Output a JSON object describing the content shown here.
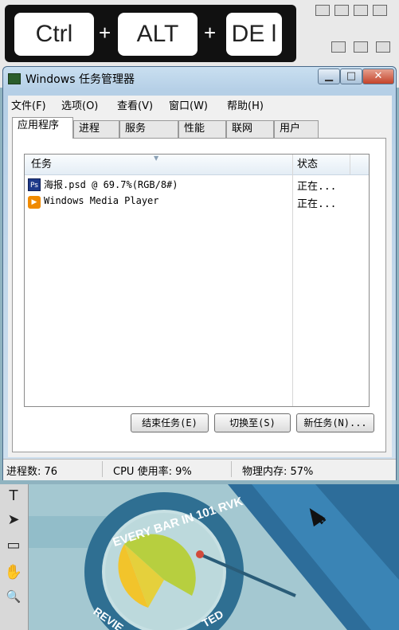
{
  "keys": {
    "ctrl": "Ctrl",
    "alt": "ALT",
    "del": "DE l",
    "plus": "+"
  },
  "window": {
    "title": "Windows 任务管理器",
    "min_label": "▁",
    "max_label": "□",
    "close_label": "✕"
  },
  "menu": [
    "文件(F)",
    "选项(O)",
    "查看(V)",
    "窗口(W)",
    "帮助(H)"
  ],
  "tabs": [
    "应用程序",
    "进程",
    "服务",
    "性能",
    "联网",
    "用户"
  ],
  "list": {
    "col_task": "任务",
    "col_status": "状态",
    "rows": [
      {
        "icon": "photoshop-icon",
        "name": "海报.psd @ 69.7%(RGB/8#)",
        "status": "正在...",
        "icon_color": "#1e3a8a"
      },
      {
        "icon": "media-player-icon",
        "name": "Windows Media Player",
        "status": "正在...",
        "icon_color": "#f08a00"
      }
    ]
  },
  "buttons": {
    "end_task": "结束任务(E)",
    "switch_to": "切换至(S)",
    "new_task": "新任务(N)..."
  },
  "status": {
    "processes": "进程数: 76",
    "cpu": "CPU 使用率: 9%",
    "memory": "物理内存: 57%"
  },
  "tools": [
    "T",
    "➤",
    "▭",
    "✋",
    "🔍"
  ],
  "ps_icon_label": "Ps",
  "background_text": "EVERY BAR IN 101 RVK",
  "background_text2": "REVIE",
  "background_text3": "TED"
}
